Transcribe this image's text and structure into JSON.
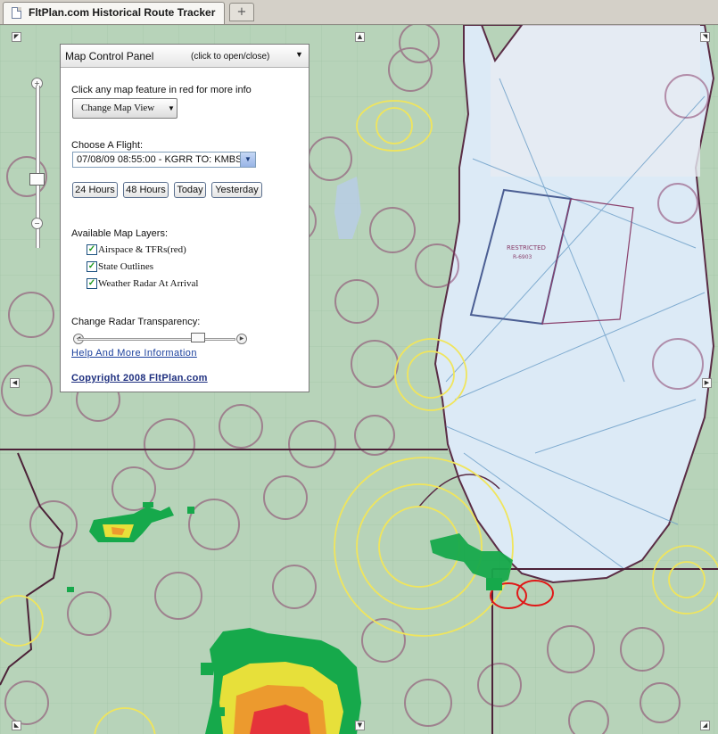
{
  "browser": {
    "tab_title": "FltPlan.com Historical Route Tracker",
    "new_tab_symbol": "+"
  },
  "panel": {
    "title": "Map Control Panel",
    "hint": "(click to open/close)",
    "instruction": "Click any map feature in red for more info",
    "change_view_label": "Change Map View",
    "choose_flight_label": "Choose A Flight:",
    "selected_flight": "07/08/09 08:55:00 - KGRR TO: KMBS",
    "quick_buttons": [
      "24 Hours",
      "48 Hours",
      "Today",
      "Yesterday"
    ],
    "layers_label": "Available Map Layers:",
    "layers": [
      {
        "label": "Airspace & TFRs(red)",
        "checked": true
      },
      {
        "label": "State Outlines",
        "checked": true
      },
      {
        "label": "Weather Radar At Arrival",
        "checked": true
      }
    ],
    "transparency_label": "Change Radar Transparency:",
    "radar_transparency_fraction": 0.76,
    "help_link": "Help And More Information",
    "copyright_link": "Copyright 2008 FltPlan.com"
  },
  "map": {
    "restricted_label": "RESTRICTED",
    "restricted_id": "R-6903",
    "colors": {
      "land": "#b7d3b9",
      "lake": "#dceaf6",
      "airspace_class_c": "#f0e55c",
      "airspace_boundary": "#8a3f6b",
      "state_line": "#4c2238",
      "tfr_red": "#e01818",
      "radar_green": "#16a94b",
      "radar_yellow": "#e7e03a",
      "radar_orange": "#ec9a2e",
      "radar_red": "#e5333a"
    }
  },
  "icons": {
    "zoom_in": "plus-icon",
    "zoom_out": "minus-icon",
    "pan": "arrow-icon"
  }
}
